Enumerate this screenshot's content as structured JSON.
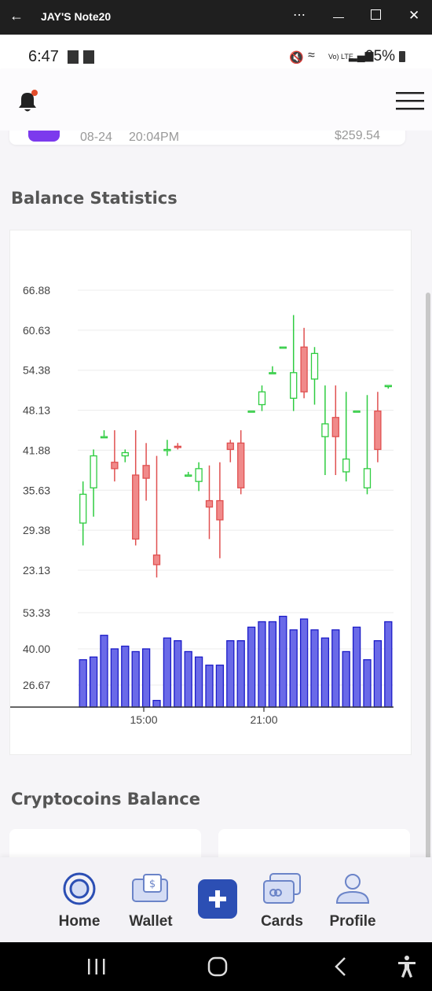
{
  "window": {
    "title": "JAY'S Note20",
    "back_icon": "arrow-left-icon",
    "controls": [
      "more-icon",
      "minimize-icon",
      "maximize-icon",
      "close-icon"
    ]
  },
  "status_bar": {
    "time": "6:47",
    "battery": "95%",
    "signal_label": "Vo) LTE"
  },
  "app_header": {
    "bell_icon": "bell-icon",
    "menu_icon": "hamburger-menu-icon"
  },
  "transaction_peek": {
    "date": "08-24",
    "time": "20:04PM",
    "amount": "$259.54"
  },
  "balance_section": {
    "title": "Balance Statistics"
  },
  "crypto_section": {
    "title": "Cryptocoins Balance"
  },
  "chart_data": {
    "type": "candlestick",
    "title": "",
    "price_axis": {
      "ticks": [
        "66.88",
        "60.63",
        "54.38",
        "48.13",
        "41.88",
        "35.63",
        "29.38",
        "23.13"
      ],
      "ylim": [
        23.13,
        66.88
      ]
    },
    "volume_axis": {
      "ticks": [
        "53.33",
        "40.00",
        "26.67"
      ],
      "ylim": [
        15,
        60
      ]
    },
    "x_ticks": [
      "15:00",
      "21:00"
    ],
    "grid": true,
    "candles": [
      {
        "o": 30.5,
        "h": 37,
        "l": 27,
        "c": 35
      },
      {
        "o": 36,
        "h": 42,
        "l": 31.5,
        "c": 41
      },
      {
        "o": 44,
        "h": 45,
        "l": 44,
        "c": 44
      },
      {
        "o": 40,
        "h": 45,
        "l": 37,
        "c": 39
      },
      {
        "o": 41,
        "h": 42,
        "l": 40,
        "c": 41.5
      },
      {
        "o": 38,
        "h": 45,
        "l": 27,
        "c": 28
      },
      {
        "o": 39.5,
        "h": 43,
        "l": 34,
        "c": 37.5
      },
      {
        "o": 25.5,
        "h": 41,
        "l": 22,
        "c": 24
      },
      {
        "o": 42,
        "h": 43.5,
        "l": 41,
        "c": 42
      },
      {
        "o": 42.5,
        "h": 43,
        "l": 42,
        "c": 42.3
      },
      {
        "o": 38,
        "h": 38.5,
        "l": 38,
        "c": 38
      },
      {
        "o": 37,
        "h": 40,
        "l": 35.5,
        "c": 39
      },
      {
        "o": 34,
        "h": 39.5,
        "l": 28,
        "c": 33
      },
      {
        "o": 34,
        "h": 40,
        "l": 25,
        "c": 31
      },
      {
        "o": 43,
        "h": 43.5,
        "l": 40,
        "c": 42
      },
      {
        "o": 43,
        "h": 45,
        "l": 35,
        "c": 36
      },
      {
        "o": 48,
        "h": 48,
        "l": 48,
        "c": 48
      },
      {
        "o": 49,
        "h": 52,
        "l": 48,
        "c": 51
      },
      {
        "o": 54,
        "h": 55,
        "l": 54,
        "c": 54
      },
      {
        "o": 58,
        "h": 58,
        "l": 58,
        "c": 58
      },
      {
        "o": 50,
        "h": 63,
        "l": 48,
        "c": 54
      },
      {
        "o": 58,
        "h": 61,
        "l": 50,
        "c": 51
      },
      {
        "o": 53,
        "h": 58,
        "l": 49,
        "c": 57
      },
      {
        "o": 44,
        "h": 52,
        "l": 38,
        "c": 46
      },
      {
        "o": 47,
        "h": 52,
        "l": 38,
        "c": 44
      },
      {
        "o": 38.5,
        "h": 51,
        "l": 37,
        "c": 40.5
      },
      {
        "o": 48,
        "h": 48,
        "l": 48,
        "c": 48
      },
      {
        "o": 36,
        "h": 50.5,
        "l": 35,
        "c": 39
      },
      {
        "o": 48,
        "h": 51,
        "l": 40,
        "c": 42
      },
      {
        "o": 52,
        "h": 52,
        "l": 51.5,
        "c": 52
      }
    ],
    "volumes": [
      36,
      37,
      45,
      40,
      41,
      39,
      40,
      21,
      44,
      43,
      39,
      37,
      34,
      34,
      43,
      43,
      48,
      50,
      50,
      52,
      47,
      51,
      47,
      44,
      47,
      39,
      48,
      36,
      43,
      50
    ]
  },
  "bottom_nav": {
    "items": [
      {
        "label": "Home",
        "icon": "home-target-icon"
      },
      {
        "label": "Wallet",
        "icon": "wallet-icon"
      },
      {
        "label": "",
        "icon": "plus-icon"
      },
      {
        "label": "Cards",
        "icon": "cards-icon"
      },
      {
        "label": "Profile",
        "icon": "profile-icon"
      }
    ]
  },
  "colors": {
    "bullish": "#2ecc40",
    "bearish": "#e05050",
    "bearish_fill": "#f08a8a",
    "volume_fill": "#6a6ae8",
    "volume_stroke": "#1c1cc8",
    "plus_button": "#2c4fb4",
    "accent_purple": "#7c3aed"
  }
}
